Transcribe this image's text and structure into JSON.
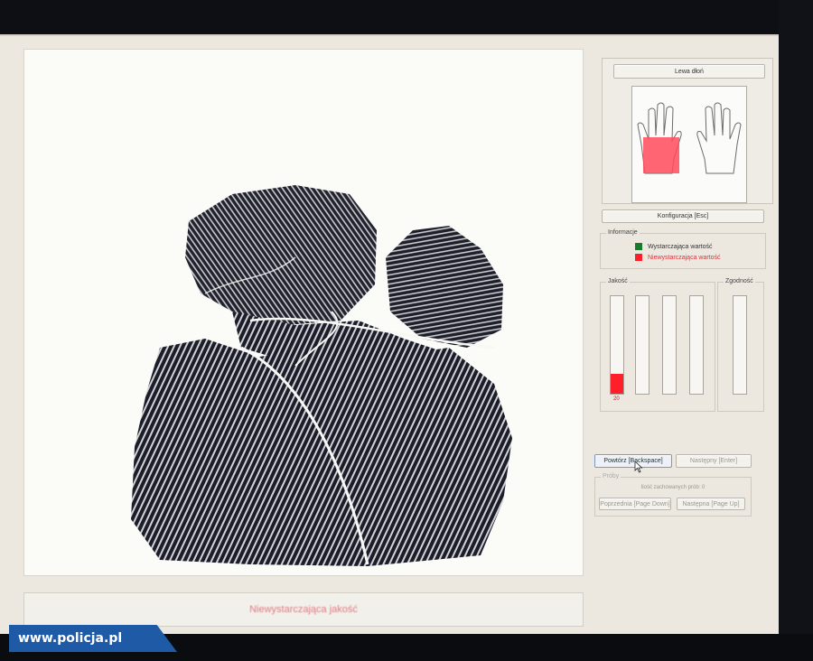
{
  "hand_panel": {
    "title_button": "Lewa dłoń",
    "selected_hand": "left",
    "highlight_color": "#ff4a5a"
  },
  "config_button": "Konfiguracja [Esc]",
  "info_group": {
    "title": "Informacje",
    "legend": [
      {
        "label": "Wystarczająca wartość",
        "color": "#1a7a2c"
      },
      {
        "label": "Niewystarczająca wartość",
        "color": "#ff1f2b"
      }
    ]
  },
  "quality_group": {
    "title": "Jakość",
    "bars": [
      {
        "value": 0.2
      },
      {
        "value": 0
      },
      {
        "value": 0
      },
      {
        "value": 0
      }
    ],
    "value_label": "20"
  },
  "agreement_group": {
    "title": "Zgodność",
    "bars": [
      {
        "value": 0
      }
    ]
  },
  "buttons": {
    "repeat": "Powtórz [Backspace]",
    "next": "Następny [Enter]"
  },
  "samples_group": {
    "title": "Próby",
    "count_text": "Ilość zachowanych prób: 0",
    "prev": "Poprzednia [Page Down]",
    "next": "Następna [Page Up]"
  },
  "status": {
    "text": "Niewystarczająca jakość"
  },
  "watermark": {
    "text": "www.policja.pl"
  },
  "icons": {
    "cursor": "pointer-cursor-icon",
    "hands": "hands-outline-icon"
  }
}
